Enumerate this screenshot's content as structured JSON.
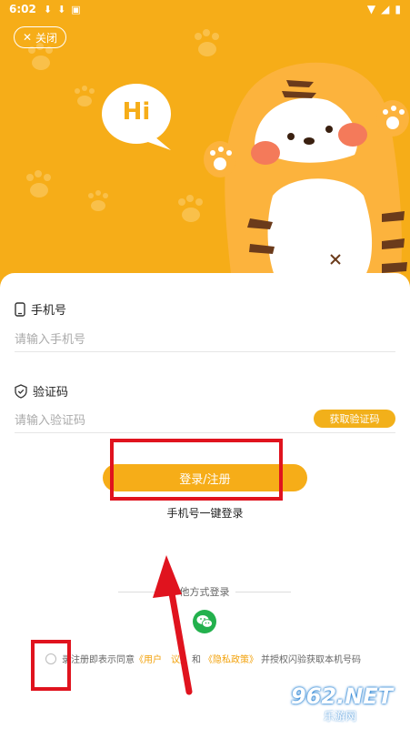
{
  "status_bar": {
    "time": "6:02",
    "icons": [
      "download-icon",
      "download-icon",
      "notification-icon",
      "wifi-icon",
      "signal-icon",
      "battery-icon"
    ]
  },
  "header": {
    "close_label": "关闭",
    "bubble_text": "Hi"
  },
  "form": {
    "phone_label": "手机号",
    "phone_placeholder": "请输入手机号",
    "code_label": "验证码",
    "code_placeholder": "请输入验证码",
    "get_code_label": "获取验证码",
    "login_button": "登录/注册",
    "quick_login": "手机号一键登录"
  },
  "other_login": {
    "label": "其他方式登录",
    "visible_label": "他方式登录",
    "options": [
      "wechat-icon"
    ]
  },
  "agreement": {
    "prefix": "录注册即表示同意",
    "user_agreement": "《用户协议》",
    "user_agreement_visible": "《用户",
    "user_agreement_obscured": "议》",
    "and": "和",
    "privacy_policy": "《隐私政策》",
    "suffix": "并授权闪验获取本机号码"
  },
  "watermark": {
    "text": "962.NET",
    "sub": "乐游网"
  },
  "colors": {
    "brand": "#f6ad18",
    "button": "#f2b01a",
    "wechat": "#23b14d",
    "annotation": "#e0131e",
    "link": "#f2a20c"
  }
}
